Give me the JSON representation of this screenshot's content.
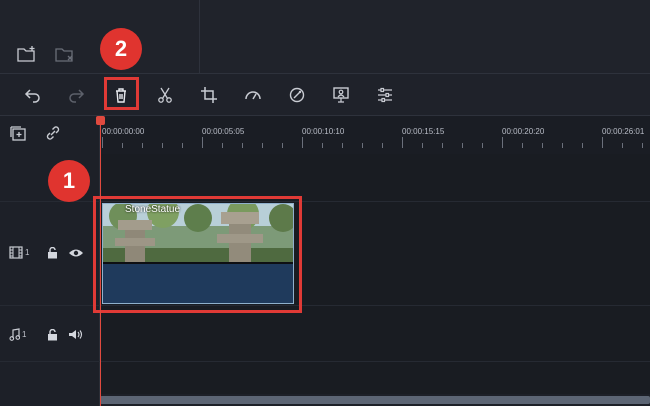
{
  "callouts": {
    "first": "1",
    "second": "2"
  },
  "toolbar": {
    "buttons": [
      "undo-icon",
      "redo-icon",
      "delete-icon",
      "cut-icon",
      "crop-icon",
      "speed-icon",
      "color-icon",
      "greenscreen-icon",
      "adjust-icon"
    ]
  },
  "ruler": {
    "labels": [
      "00:00:00:00",
      "00:00:05:05",
      "00:00:10:10",
      "00:00:15:15",
      "00:00:20:20",
      "00:00:26:01"
    ]
  },
  "tracks": {
    "video": {
      "number": "1"
    },
    "audio": {
      "number": "1"
    }
  },
  "clip": {
    "title": "StoneStatue"
  },
  "colors": {
    "accent": "#e0342f",
    "clip_bg": "#1f3a5c",
    "playhead": "#e04a3f"
  }
}
